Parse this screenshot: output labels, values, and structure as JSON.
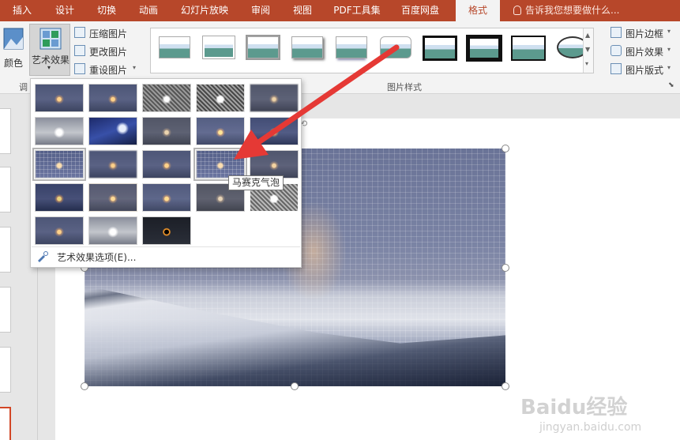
{
  "tabs": [
    "插入",
    "设计",
    "切换",
    "动画",
    "幻灯片放映",
    "审阅",
    "视图",
    "PDF工具集",
    "百度网盘",
    "格式"
  ],
  "active_tab": "格式",
  "tell_me": "告诉我您想要做什么...",
  "ribbon": {
    "color_label": "颜色",
    "artistic_label": "艺术效果",
    "compress_label": "压缩图片",
    "change_label": "更改图片",
    "reset_label": "重设图片",
    "adjust_label": "调",
    "styles_group": "图片样式",
    "border_label": "图片边框",
    "effects_label": "图片效果",
    "layout_label": "图片版式"
  },
  "dropdown": {
    "option_label": "艺术效果选项(E)...",
    "hover_tooltip": "马赛克气泡"
  },
  "watermark": {
    "logo": "Baidu经验",
    "url": "jingyan.baidu.com"
  },
  "colors": {
    "accent": "#b7472a",
    "arrow": "#e53935"
  }
}
